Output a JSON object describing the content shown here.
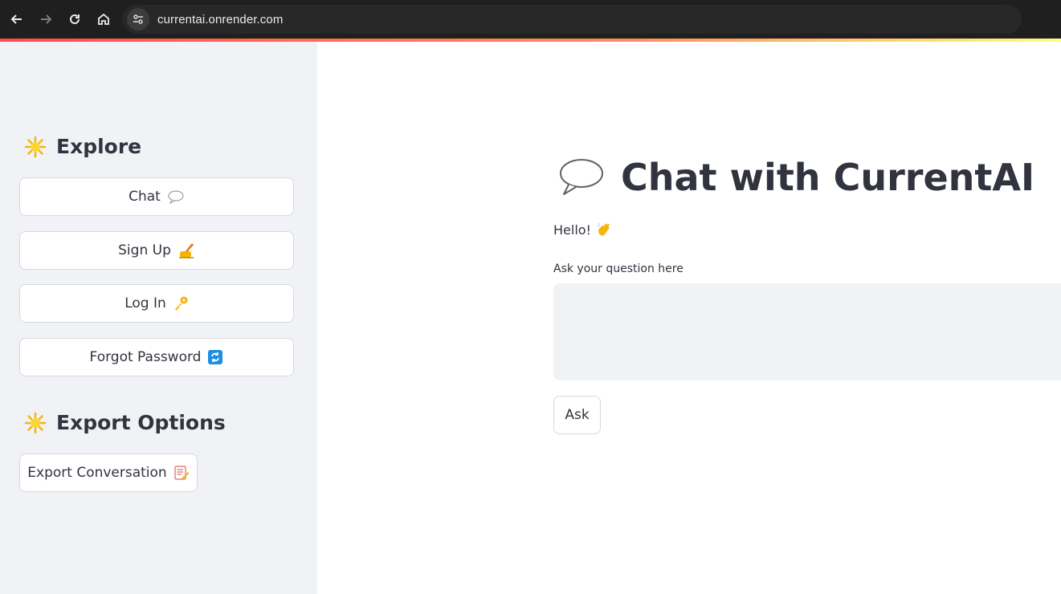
{
  "browser": {
    "url": "currentai.onrender.com",
    "icons": [
      "back-arrow-icon",
      "forward-arrow-icon",
      "reload-icon",
      "home-icon",
      "site-info-icon"
    ]
  },
  "sidebar": {
    "explore_heading": "Explore",
    "nav_buttons": [
      {
        "label": "Chat",
        "icon": "speech-balloon-icon"
      },
      {
        "label": "Sign Up",
        "icon": "writing-hand-icon"
      },
      {
        "label": "Log In",
        "icon": "key-icon"
      },
      {
        "label": "Forgot Password",
        "icon": "arrows-cycle-icon"
      }
    ],
    "export_heading": "Export Options",
    "export_button": {
      "label": "Export Conversation",
      "icon": "memo-icon"
    }
  },
  "main": {
    "title": "Chat with CurrentAI",
    "greeting": "Hello!",
    "question_label": "Ask your question here",
    "question_value": "",
    "ask_button": "Ask"
  },
  "colors": {
    "sidebar_bg": "#f0f2f6",
    "text": "#31333f",
    "accent_red": "#ff4b4b",
    "accent_yellow": "#fffd80"
  }
}
